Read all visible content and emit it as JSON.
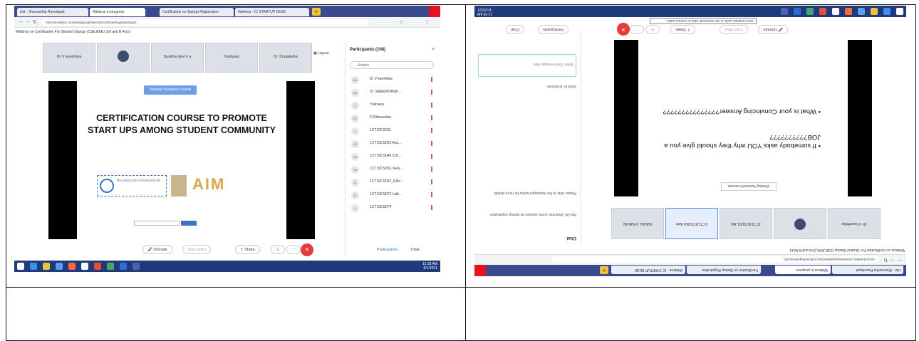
{
  "shot1": {
    "tabs": [
      {
        "label": "Ust - Shamantha Ravulapati"
      },
      {
        "label": "Webinar in progress"
      },
      {
        "label": "Certification on Startup Registration"
      },
      {
        "label": "Webinar - IC STARTUP DESK"
      }
    ],
    "url": "ramcod.webex.com/webappng/sites/ramcod/meeting/download/...",
    "meeting_title": "Webinar on Certification For Student Startup (CSE,EEE,Civil and B Arch)",
    "tiles": [
      "Dr V keerthika",
      "Suvitha devi k a",
      "Yoshasvi",
      "Dr Tinulaksha"
    ],
    "layout_label": "Layout",
    "sharing_label": "Viewing Yoshasvi's screen",
    "slide_title": "CERTIFICATION COURSE TO PROMOTE START UPS AMONG STUDENT COMMUNITY",
    "logo_seal_text": "TECHNOLOGY FOUNDATION",
    "logo_aim": "AIM",
    "participants_title": "Participants (108)",
    "search_placeholder": "Search",
    "participants": [
      {
        "badge": "DK",
        "name": "Dr V keerthika"
      },
      {
        "badge": "DS",
        "name": "Dr. SREENIVASA ..."
      },
      {
        "badge": "Y",
        "name": "Yoshasvi"
      },
      {
        "badge": "DT",
        "name": "D Nitesnesha"
      },
      {
        "badge": "1",
        "name": "1CT19CS011"
      },
      {
        "badge": "1C",
        "name": "1CT19CS022 Apo..."
      },
      {
        "badge": "1S",
        "name": "1CT19CS049 S B..."
      },
      {
        "badge": "1S",
        "name": "1CT19CS051 Jeev..."
      },
      {
        "badge": "1L",
        "name": "1CT19CS057_KAV..."
      },
      {
        "badge": "1L",
        "name": "1CT19CS072 Lalit..."
      },
      {
        "badge": "1",
        "name": "1CT19CS074"
      }
    ],
    "participants_tab": "Participants",
    "chat_tab": "Chat",
    "controls": {
      "unmute": "Unmute",
      "start_video": "Start video",
      "share": "Share"
    },
    "clock": {
      "time": "11:33 AM",
      "date": "6/1/2021"
    }
  },
  "shot2": {
    "sharing_label": "Viewing Yoshasvi's screen",
    "bullets": [
      "What is your Convincing Answer???????????????",
      "If somebody asks YOU why they should give you a JOB??????????"
    ],
    "tiles": [
      "Dr V keerthika",
      "1CT19CS001 Abi",
      "1CT19CS004 Abh",
      "NAVAL V.NAVIN"
    ],
    "chat_title": "Chat",
    "chat_messages": [
      "Hey All, Welcome to the session on startup registration.",
      "Please refer to the messages below for more details"
    ],
    "send_to_label": "Send to",
    "send_to_value": "Everyone",
    "chat_placeholder": "Enter chat message here",
    "tooltip": "Your computer audio is not connected. Click to connect audio.",
    "controls": {
      "unmute": "Unmute",
      "start_video": "Start video",
      "share": "Share"
    },
    "participants_tab": "Participants",
    "chat_tab": "Chat",
    "meeting_title": "Webinar on Certification For Student Startup (CSE,EEE,Civil and B Arch)",
    "clock": {
      "time": "11:39 AM",
      "date": "6/1/2021"
    }
  }
}
